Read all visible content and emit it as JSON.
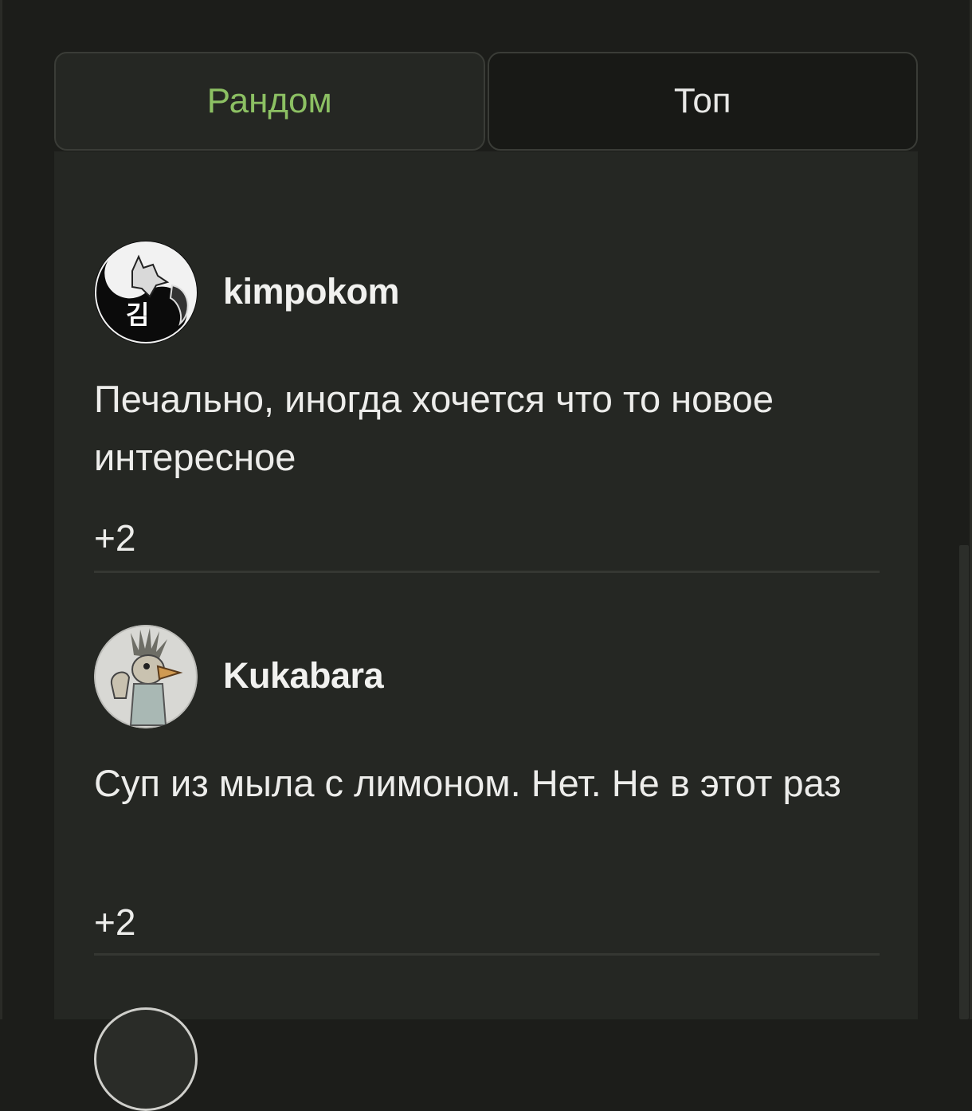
{
  "tabs": [
    {
      "label": "Рандом",
      "active": true
    },
    {
      "label": "Топ",
      "active": false
    }
  ],
  "colors": {
    "accent": "#8cc063",
    "panel": "#252723",
    "background": "#1c1d1a",
    "text": "#ededeb"
  },
  "comments": [
    {
      "username": "kimpokom",
      "avatar_icon": "fox-yin-yang-avatar-icon",
      "avatar_text": "김",
      "text": "Печально, иногда хочется что то новое интересное",
      "rating": "+2"
    },
    {
      "username": "Kukabara",
      "avatar_icon": "bird-drawing-avatar-icon",
      "text": "Суп из мыла с лимоном. Нет. Не в этот раз",
      "rating": "+2"
    }
  ]
}
